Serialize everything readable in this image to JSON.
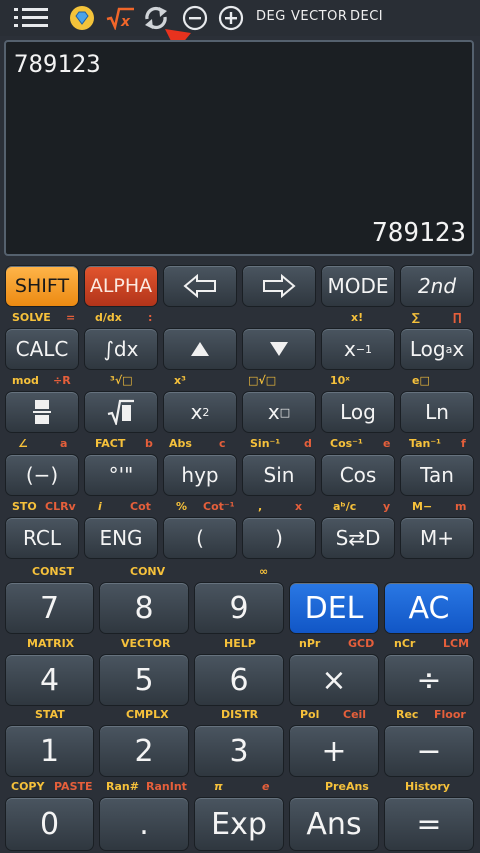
{
  "toolbar": {
    "menu_icon": "hamburger-menu-icon",
    "mode_labels": [
      "DEG",
      "VECTOR",
      "DECI"
    ]
  },
  "display": {
    "input": "789123",
    "result": "789123"
  },
  "colors": {
    "shift": "#f59a1e",
    "alpha": "#c9411f",
    "blue": "#1f6fe0",
    "yellow_label": "#f6c13b",
    "red_label": "#e55f3b"
  },
  "row1": {
    "shift": "SHIFT",
    "alpha": "ALPHA",
    "mode": "MODE",
    "second": "2nd"
  },
  "labels1": {
    "solve": "SOLVE",
    "eq": "=",
    "ddx": "d/dx",
    "colon": ":",
    "fact_excl": "x!",
    "sum": "∑",
    "prod": "∏"
  },
  "row2": {
    "calc": "CALC"
  },
  "labels2": {
    "mod": "mod",
    "divr": "÷R",
    "cbrt": "³√□",
    "cube": "x³",
    "nroot": "□√□",
    "tenx": "10ˣ",
    "ex": "e□"
  },
  "labels3": {
    "angle": "∠",
    "a": "a",
    "fact": "FACT",
    "b": "b",
    "abs": "Abs",
    "c": "c",
    "asin": "Sin⁻¹",
    "d": "d",
    "acos": "Cos⁻¹",
    "e": "e",
    "atan": "Tan⁻¹",
    "f": "f"
  },
  "row4": {
    "neg": "(−)",
    "dms": "°'\"",
    "hyp": "hyp",
    "sin": "Sin",
    "cos": "Cos",
    "tan": "Tan"
  },
  "labels4": {
    "sto": "STO",
    "clrv": "CLRv",
    "i": "i",
    "cot": "Cot",
    "pct": "%",
    "acot": "Cot⁻¹",
    "comma": ",",
    "x": "x",
    "abc": "aᵇ/c",
    "y": "y",
    "mminus": "M−",
    "m": "m"
  },
  "row5": {
    "rcl": "RCL",
    "eng": "ENG",
    "lparen": "(",
    "rparen": ")",
    "sd": "S⇄D",
    "mplus": "M+"
  },
  "labels5": {
    "const": "CONST",
    "conv": "CONV",
    "inf": "∞"
  },
  "row6": {
    "seven": "7",
    "eight": "8",
    "nine": "9",
    "del": "DEL",
    "ac": "AC"
  },
  "labels6": {
    "matrix": "MATRIX",
    "vector": "VECTOR",
    "help": "HELP",
    "npr": "nPr",
    "gcd": "GCD",
    "ncr": "nCr",
    "lcm": "LCM"
  },
  "row7": {
    "four": "4",
    "five": "5",
    "six": "6",
    "mul": "×",
    "div": "÷"
  },
  "labels7": {
    "stat": "STAT",
    "cmplx": "CMPLX",
    "distr": "DISTR",
    "pol": "Pol",
    "ceil": "Ceil",
    "rec": "Rec",
    "floor": "Floor"
  },
  "row8": {
    "one": "1",
    "two": "2",
    "three": "3",
    "plus": "+",
    "minus": "−"
  },
  "labels8": {
    "copy": "COPY",
    "paste": "PASTE",
    "ranhash": "Ran#",
    "ranint": "RanInt",
    "pi": "π",
    "e": "e",
    "preans": "PreAns",
    "history": "History"
  },
  "row9": {
    "zero": "0",
    "dot": ".",
    "exp": "Exp",
    "ans": "Ans",
    "equals": "="
  }
}
